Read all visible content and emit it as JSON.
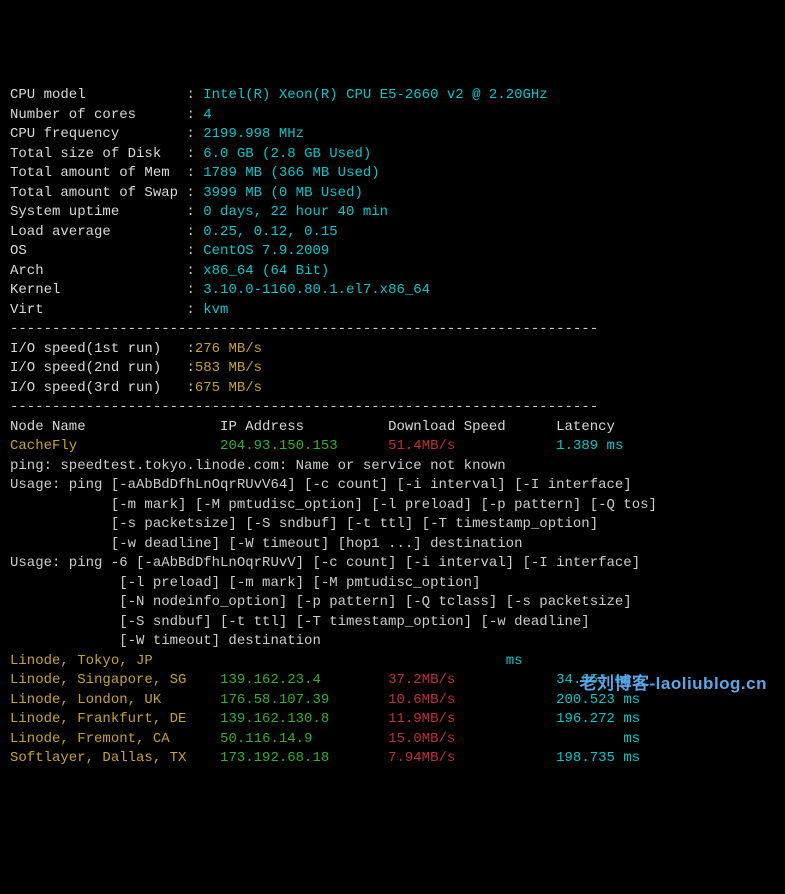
{
  "sys": {
    "labels": {
      "cpu_model": "CPU model",
      "cores": "Number of cores",
      "freq": "CPU frequency",
      "disk": "Total size of Disk",
      "mem": "Total amount of Mem",
      "swap": "Total amount of Swap",
      "uptime": "System uptime",
      "load": "Load average",
      "os": "OS",
      "arch": "Arch",
      "kernel": "Kernel",
      "virt": "Virt"
    },
    "values": {
      "cpu_model": "Intel(R) Xeon(R) CPU E5-2660 v2 @ 2.20GHz",
      "cores": "4",
      "freq": "2199.998 MHz",
      "disk": "6.0 GB (2.8 GB Used)",
      "mem": "1789 MB (366 MB Used)",
      "swap": "3999 MB (0 MB Used)",
      "uptime": "0 days, 22 hour 40 min",
      "load": "0.25, 0.12, 0.15",
      "os": "CentOS 7.9.2009",
      "arch": "x86_64 (64 Bit)",
      "kernel": "3.10.0-1160.80.1.el7.x86_64",
      "virt": "kvm"
    }
  },
  "io": {
    "labels": {
      "r1": "I/O speed(1st run)",
      "r2": "I/O speed(2nd run)",
      "r3": "I/O speed(3rd run)"
    },
    "values": {
      "r1": "276 MB/s",
      "r2": "583 MB/s",
      "r3": "675 MB/s"
    }
  },
  "headers": {
    "node": "Node Name",
    "ip": "IP Address",
    "speed": "Download Speed",
    "latency": "Latency"
  },
  "cachefly": {
    "name": "CacheFly",
    "ip": "204.93.150.153",
    "speed": "51.4MB/s",
    "latency": "1.389 ms"
  },
  "error": "ping: speedtest.tokyo.linode.com: Name or service not known",
  "usage": {
    "l1": "Usage: ping [-aAbBdDfhLnOqrRUvV64] [-c count] [-i interval] [-I interface]",
    "l2": "            [-m mark] [-M pmtudisc_option] [-l preload] [-p pattern] [-Q tos]",
    "l3": "            [-s packetsize] [-S sndbuf] [-t ttl] [-T timestamp_option]",
    "l4": "            [-w deadline] [-W timeout] [hop1 ...] destination",
    "l5": "Usage: ping -6 [-aAbBdDfhLnOqrRUvV] [-c count] [-i interval] [-I interface]",
    "l6": "             [-l preload] [-m mark] [-M pmtudisc_option]",
    "l7": "             [-N nodeinfo_option] [-p pattern] [-Q tclass] [-s packetsize]",
    "l8": "             [-S sndbuf] [-t ttl] [-T timestamp_option] [-w deadline]",
    "l9": "             [-W timeout] destination"
  },
  "nodes": [
    {
      "name": "Linode, Tokyo, JP",
      "ip": "",
      "speed": "",
      "latency": "      ms"
    },
    {
      "name": "Linode, Singapore, SG",
      "ip": "139.162.23.4",
      "speed": "37.2MB/s",
      "latency": "34.654 ms"
    },
    {
      "name": "Linode, London, UK",
      "ip": "176.58.107.39",
      "speed": "10.6MB/s",
      "latency": "200.523 ms"
    },
    {
      "name": "Linode, Frankfurt, DE",
      "ip": "139.162.130.8",
      "speed": "11.9MB/s",
      "latency": "196.272 ms"
    },
    {
      "name": "Linode, Fremont, CA",
      "ip": "50.116.14.9",
      "speed": "15.0MB/s",
      "latency": "        ms"
    },
    {
      "name": "Softlayer, Dallas, TX",
      "ip": "173.192.68.18",
      "speed": "7.94MB/s",
      "latency": "198.735 ms"
    }
  ],
  "divider": "----------------------------------------------------------------------",
  "watermark": "老刘博客-laoliublog.cn"
}
